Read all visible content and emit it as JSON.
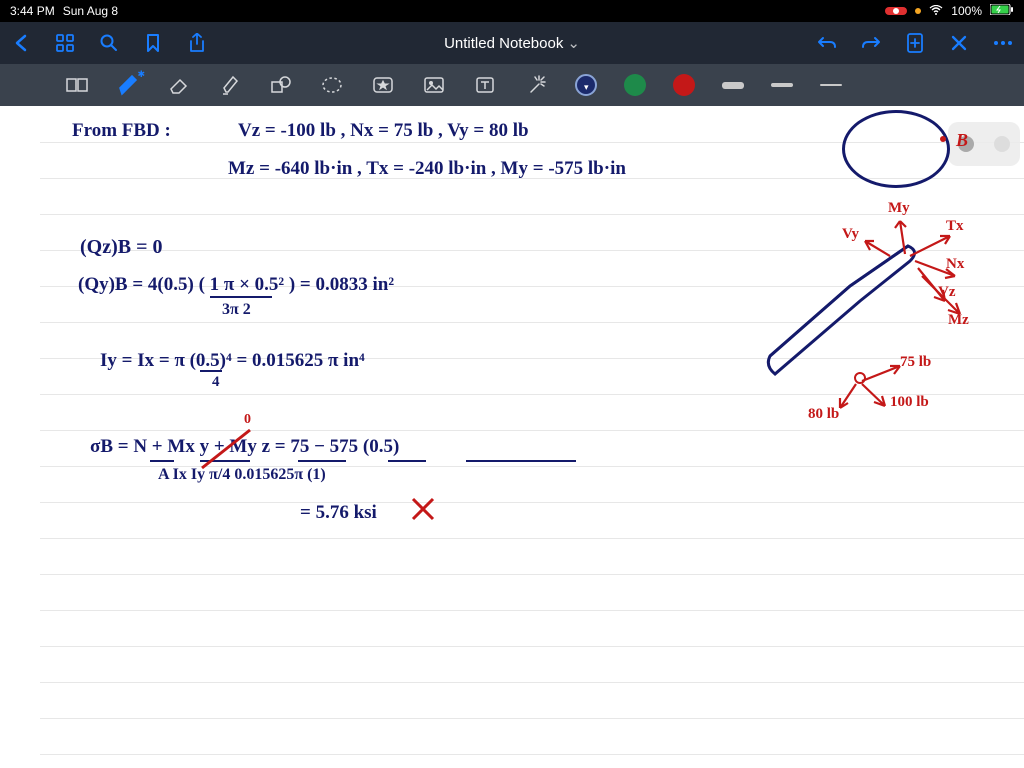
{
  "statusbar": {
    "time": "3:44 PM",
    "date": "Sun Aug 8",
    "battery": "100%"
  },
  "navbar": {
    "title": "Untitled Notebook",
    "chevron": "⌄"
  },
  "toolbar": {
    "colors": {
      "navy": "#1b2a6b",
      "green": "#1e8a4a",
      "red": "#c41818"
    }
  },
  "notes": {
    "l1a": "From FBD :",
    "l1b": "Vz = -100 lb ,  Nx = 75 lb ,  Vy = 80 lb",
    "l2": "Mz = -640 lb·in ,  Tx = -240 lb·in ,  My = -575 lb·in",
    "l3": "(Qz)B  =  0",
    "l4": "(Qy)B  =   4(0.5)  ( 1  π × 0.5² )  =  0.0833  in²",
    "l4b": "3π        2",
    "l5": "Iy = Ix =  π  (0.5)⁴ =  0.015625 π  in⁴",
    "l5b": "4",
    "l6": "σB =  N  +  Mx y   +   My z   =   75   −   575 (0.5)",
    "l6b": "A       Ix           Iy        π/4      0.015625π (1)",
    "l7": "=   5.76  ksi",
    "dlabels": {
      "B": "B",
      "My": "My",
      "Tx": "Tx",
      "Vy": "Vy",
      "Nx": "Nx",
      "Vz": "Vz",
      "Mz": "Mz",
      "f75": "75 lb",
      "f100": "100 lb",
      "f80": "80 lb"
    }
  }
}
